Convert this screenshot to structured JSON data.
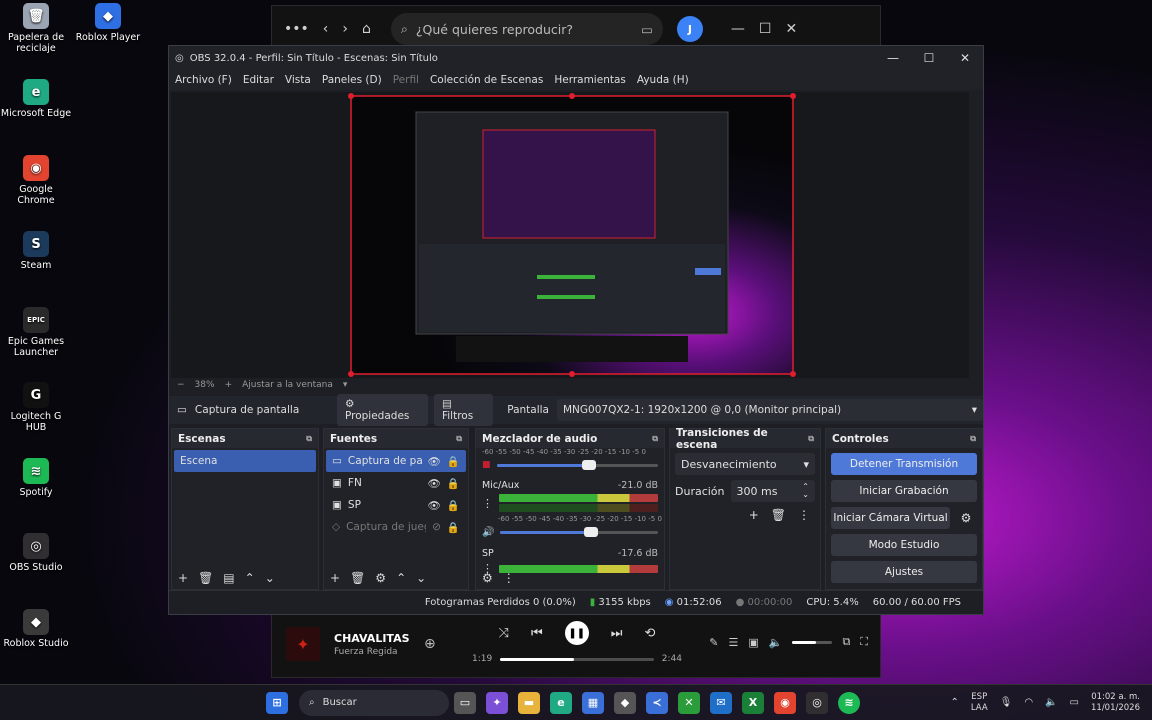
{
  "desktop": {
    "icons": [
      {
        "label": "Papelera de reciclaje",
        "color": "#9aa4b2",
        "glyph": "🗑"
      },
      {
        "label": "Microsoft Edge",
        "color": "#1faa84",
        "glyph": "e"
      },
      {
        "label": "Google Chrome",
        "color": "#e3442f",
        "glyph": "◉"
      },
      {
        "label": "Steam",
        "color": "#1b3a5c",
        "glyph": "S"
      },
      {
        "label": "Epic Games Launcher",
        "color": "#2a2a2a",
        "glyph": "EPIC"
      },
      {
        "label": "Logitech G HUB",
        "color": "#111111",
        "glyph": "G"
      },
      {
        "label": "Spotify",
        "color": "#1db954",
        "glyph": "≋"
      },
      {
        "label": "OBS Studio",
        "color": "#302e31",
        "glyph": "◎"
      },
      {
        "label": "Roblox Studio",
        "color": "#3a3a3a",
        "glyph": "◆"
      }
    ],
    "extra_icon": {
      "label": "Roblox Player",
      "color": "#2f6fe4",
      "glyph": "◆"
    }
  },
  "spotify": {
    "search_placeholder": "¿Qué quieres reproducir?",
    "avatar_letter": "J",
    "track_title": "CHAVALITAS",
    "track_artist": "Fuerza Regida",
    "elapsed": "1:19",
    "duration": "2:44",
    "progress_fraction": 0.48,
    "volume_fraction": 0.6
  },
  "obs": {
    "title": "OBS 32.0.4 - Perfil: Sin Título - Escenas: Sin Título",
    "menu": [
      "Archivo (F)",
      "Editar",
      "Vista",
      "Paneles (D)",
      "Perfil",
      "Colección de Escenas",
      "Herramientas",
      "Ayuda (H)"
    ],
    "menu_disabled_index": 4,
    "zoom": "38%",
    "zoom_fit": "Ajustar a la ventana",
    "source_bar": {
      "selected_source": "Captura de pantalla",
      "properties": "Propiedades",
      "filters": "Filtros",
      "display_label": "Pantalla",
      "display_value": "MNG007QX2-1: 1920x1200 @ 0,0 (Monitor principal)"
    },
    "scenes": {
      "header": "Escenas",
      "items": [
        "Escena"
      ]
    },
    "sources": {
      "header": "Fuentes",
      "items": [
        {
          "label": "Captura de panta",
          "icon": "monitor-icon",
          "visible": true,
          "selected": true
        },
        {
          "label": "FN",
          "icon": "image-icon",
          "visible": true,
          "selected": false
        },
        {
          "label": "SP",
          "icon": "image-icon",
          "visible": true,
          "selected": false
        },
        {
          "label": "Captura de juego",
          "icon": "gamepad-icon",
          "visible": false,
          "selected": false
        }
      ]
    },
    "mixer": {
      "header": "Mezclador de audio",
      "scale": "-60 -55 -50 -45 -40 -35 -30 -25 -20 -15 -10 -5 0",
      "channels": [
        {
          "name": "Mic/Aux",
          "db": "-21.0 dB"
        },
        {
          "name": "SP",
          "db": "-17.6 dB"
        }
      ]
    },
    "transitions": {
      "header": "Transiciones de escena",
      "selected": "Desvanecimiento",
      "duration_label": "Duración",
      "duration_value": "300 ms"
    },
    "controls": {
      "header": "Controles",
      "buttons": [
        "Detener Transmisión",
        "Iniciar Grabación",
        "Iniciar Cámara Virtual",
        "Modo Estudio",
        "Ajustes"
      ],
      "accent": "#4f79d9"
    },
    "status": {
      "dropped": "Fotogramas Perdidos 0 (0.0%)",
      "bitrate": "3155 kbps",
      "stream_time": "01:52:06",
      "rec_time": "00:00:00",
      "cpu": "CPU: 5.4%",
      "fps": "60.00 / 60.00 FPS"
    }
  },
  "taskbar": {
    "search": "Buscar",
    "lang_top": "ESP",
    "lang_bottom": "LAA",
    "time": "01:02 a. m.",
    "date": "11/01/2026"
  }
}
